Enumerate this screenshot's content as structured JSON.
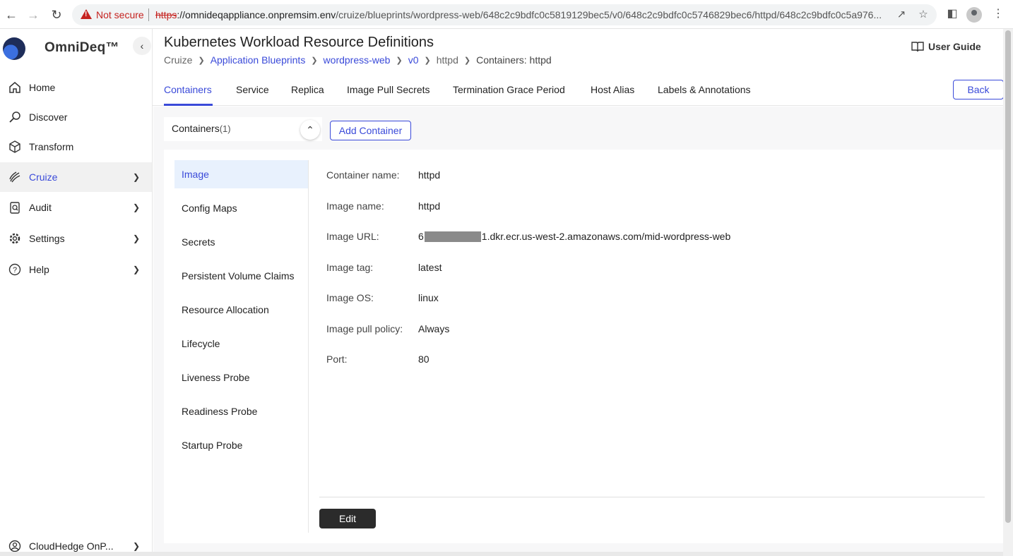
{
  "browser": {
    "not_secure": "Not secure",
    "url_proto": "https",
    "url_host": "://omnideqappliance.onpremsim.env",
    "url_path": "/cruize/blueprints/wordpress-web/648c2c9bdfc0c5819129bec5/v0/648c2c9bdfc0c5746829bec6/httpd/648c2c9bdfc0c5a976...",
    "icons": [
      "back-arrow-icon",
      "forward-arrow-icon",
      "reload-icon",
      "share-icon",
      "star-icon",
      "side-panel-icon",
      "profile-icon",
      "more-vert-icon"
    ]
  },
  "sidebar": {
    "brand": "OmniDeq™",
    "items": [
      {
        "label": "Home",
        "icon": "home-icon"
      },
      {
        "label": "Discover",
        "icon": "discover-icon"
      },
      {
        "label": "Transform",
        "icon": "cube-icon"
      },
      {
        "label": "Cruize",
        "icon": "cruize-icon"
      },
      {
        "label": "Audit",
        "icon": "audit-icon"
      },
      {
        "label": "Settings",
        "icon": "gear-icon"
      },
      {
        "label": "Help",
        "icon": "help-icon"
      }
    ],
    "footer": "CloudHedge OnP..."
  },
  "header": {
    "title": "Kubernetes Workload Resource Definitions",
    "breadcrumb": [
      "Cruize",
      "Application Blueprints",
      "wordpress-web",
      "v0",
      "httpd",
      "Containers: httpd"
    ],
    "user_guide": "User Guide"
  },
  "tabs": [
    "Containers",
    "Service",
    "Replica",
    "Image Pull Secrets",
    "Termination Grace Period",
    "Host Alias",
    "Labels & Annotations"
  ],
  "back_label": "Back",
  "containers": {
    "label": "Containers",
    "count": "(1)",
    "add_label": "Add Container"
  },
  "sub_nav": [
    "Image",
    "Config Maps",
    "Secrets",
    "Persistent Volume Claims",
    "Resource Allocation",
    "Lifecycle",
    "Liveness Probe",
    "Readiness Probe",
    "Startup Probe"
  ],
  "fields": [
    {
      "label": "Container name:",
      "value": "httpd"
    },
    {
      "label": "Image name:",
      "value": "httpd"
    },
    {
      "label": "Image URL:",
      "value_prefix": "6",
      "value_suffix": "1.dkr.ecr.us-west-2.amazonaws.com/mid-wordpress-web"
    },
    {
      "label": "Image tag:",
      "value": "latest"
    },
    {
      "label": "Image OS:",
      "value": "linux"
    },
    {
      "label": "Image pull policy:",
      "value": "Always"
    },
    {
      "label": "Port:",
      "value": "80"
    }
  ],
  "edit_label": "Edit"
}
